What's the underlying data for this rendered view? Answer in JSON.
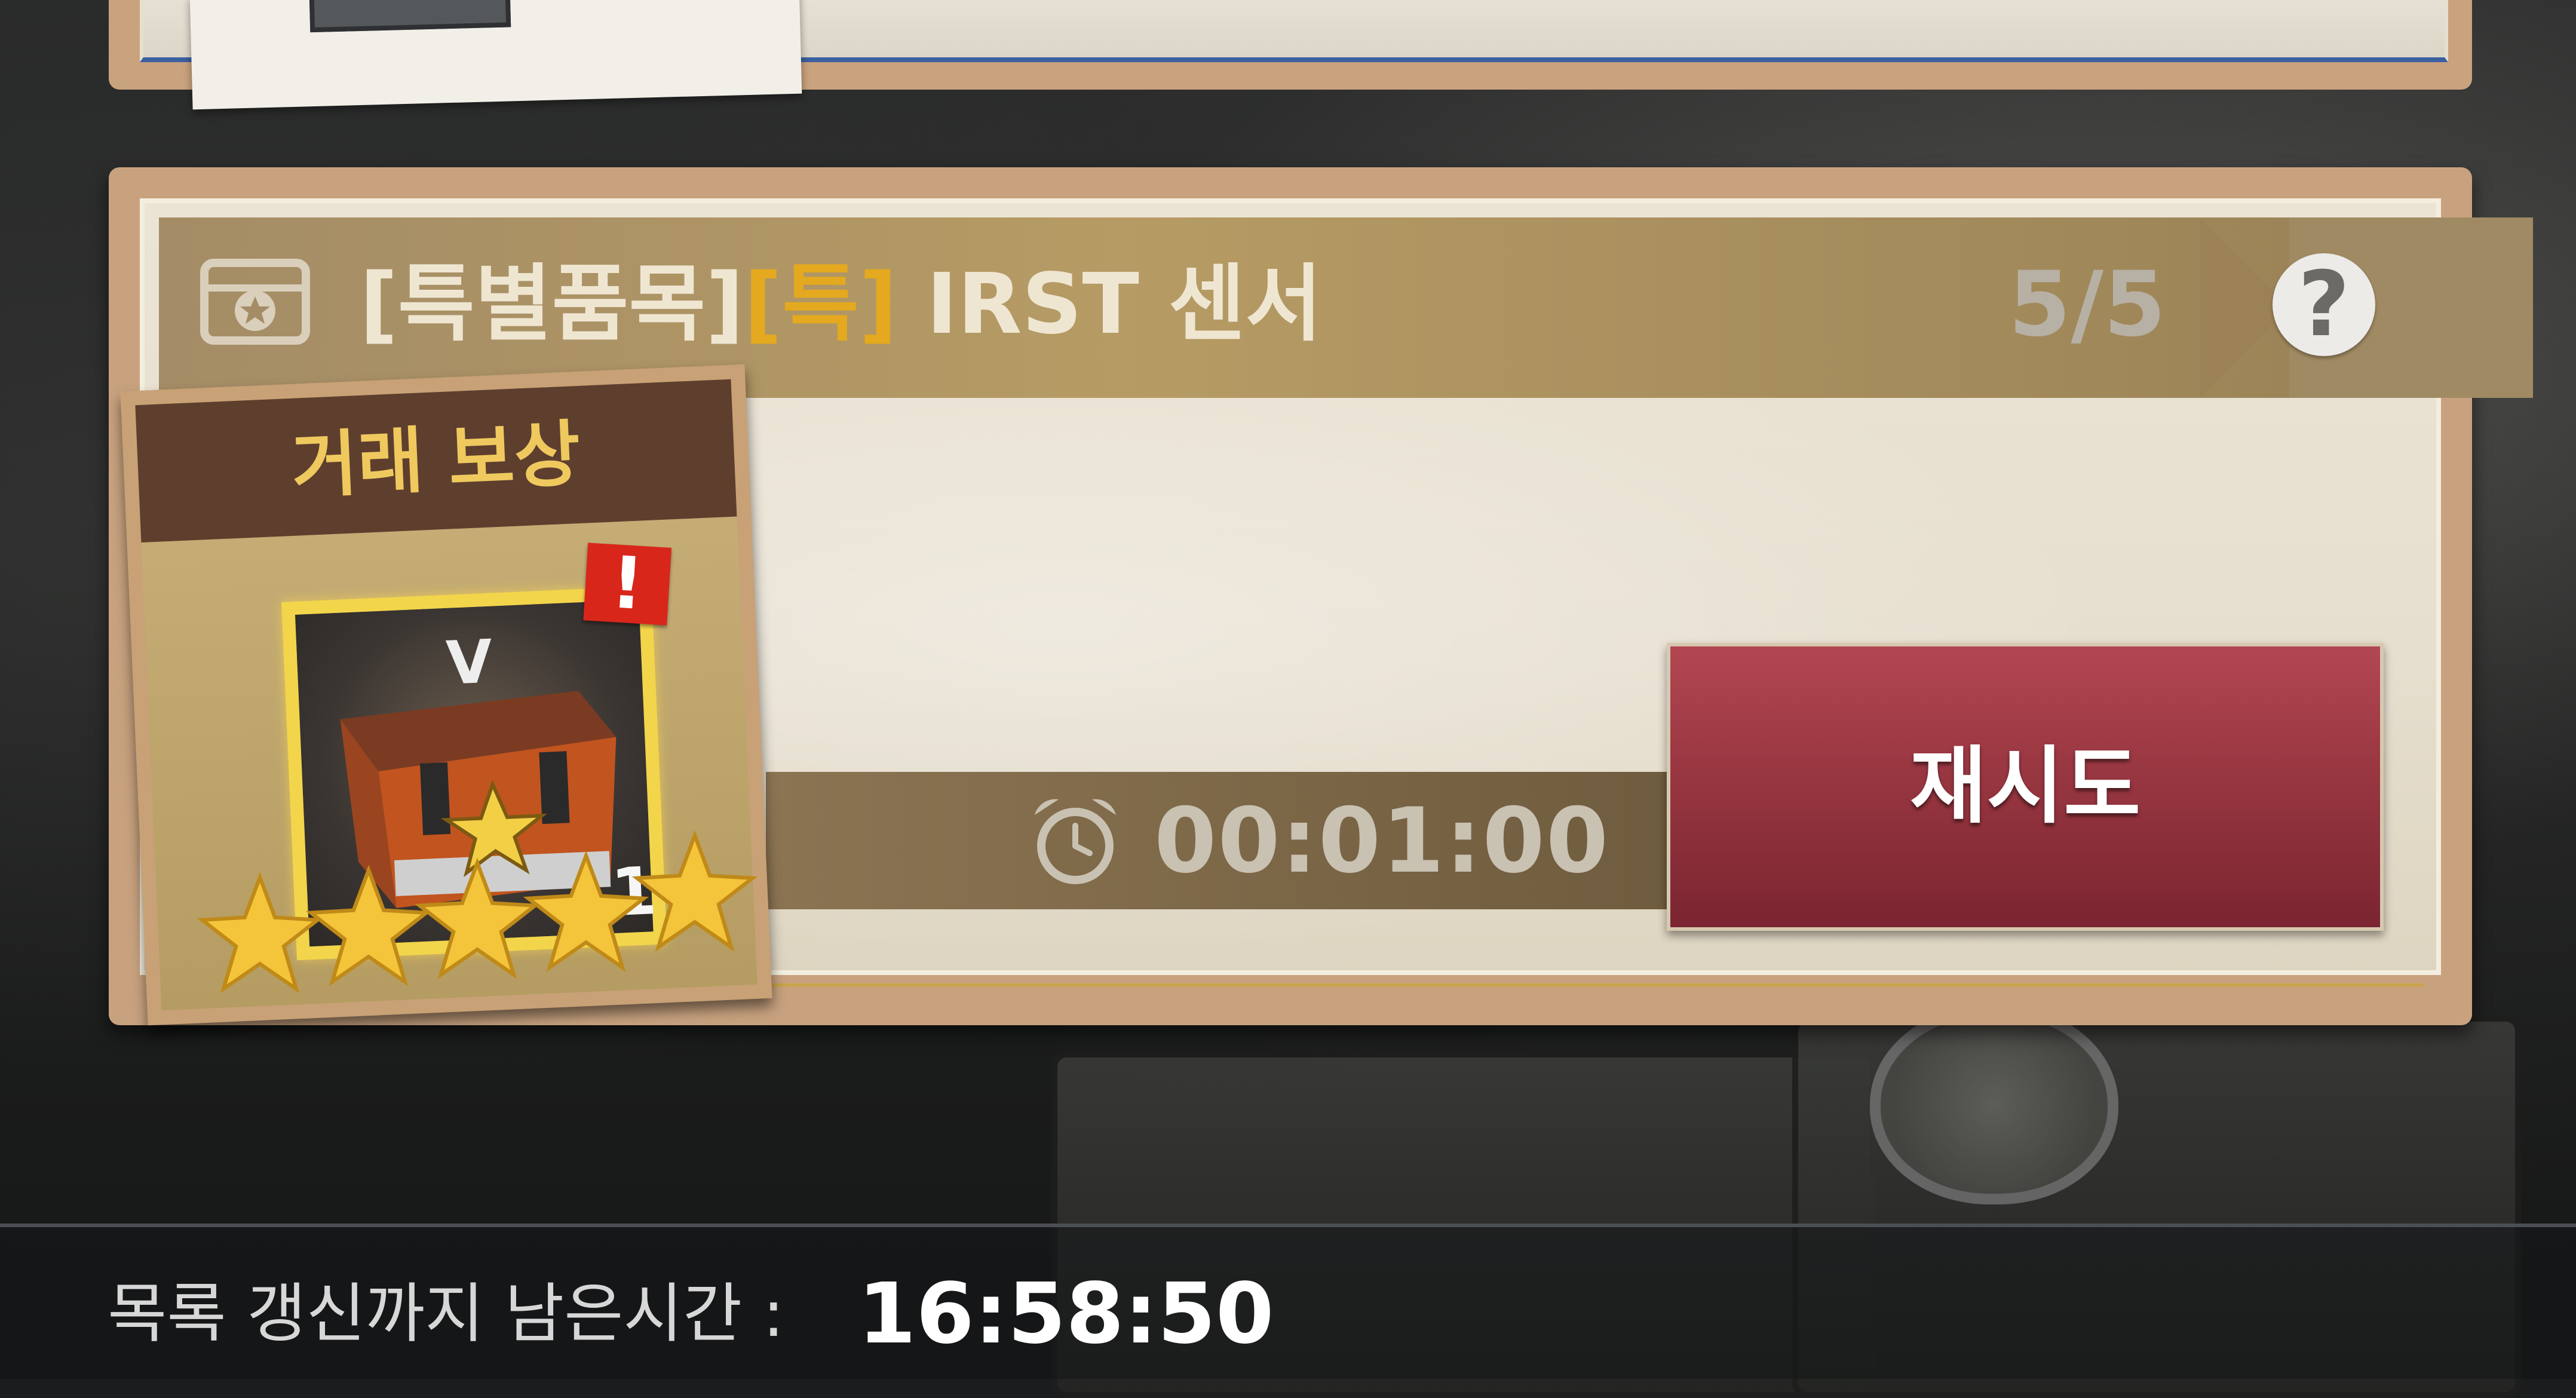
{
  "offer": {
    "title_prefix": "[특별품목]",
    "title_grade": "[특]",
    "title_name": " IRST 센서",
    "count": "5/5",
    "help_label": "?",
    "timer": "00:01:00",
    "retry_label": "재시도"
  },
  "reward": {
    "title": "거래 보상",
    "grade": "V",
    "quantity": "1",
    "alert": "!",
    "stars": 5
  },
  "footer": {
    "label": "목록 갱신까지 남은시간 :",
    "time": "16:58:50"
  },
  "colors": {
    "grade_accent": "#e4a91e",
    "retry_button": "#9e3a44",
    "alert_badge": "#d8261b",
    "star": "#f4c43a"
  }
}
